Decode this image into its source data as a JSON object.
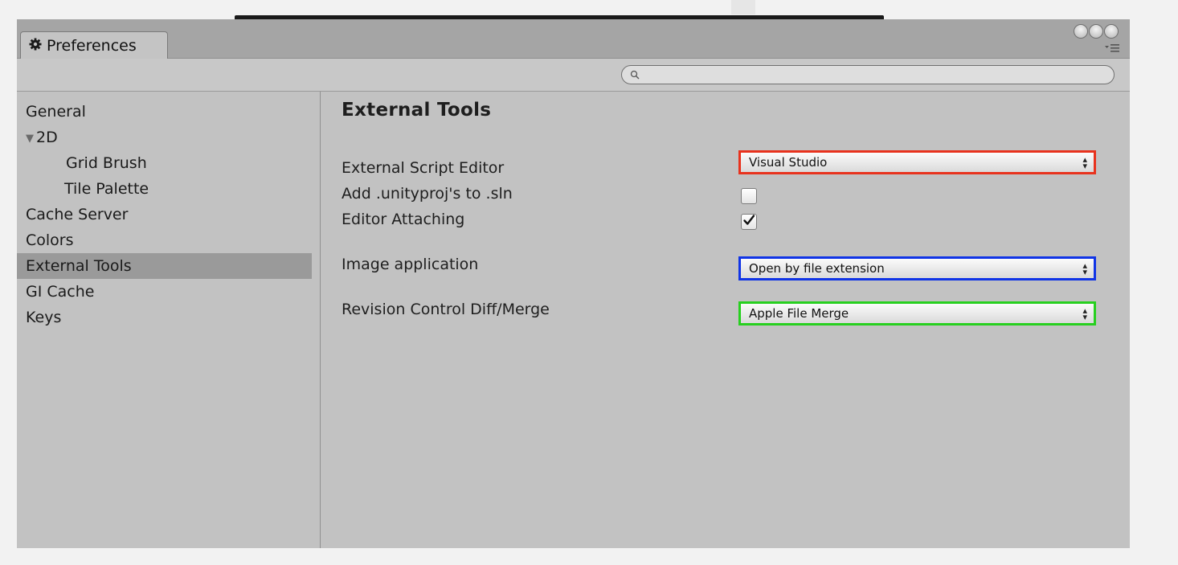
{
  "window": {
    "tab_title": "Preferences",
    "icons": {
      "tab": "gear-icon",
      "search": "search-icon",
      "menu": "menu-icon",
      "window_buttons": "circle-button-icon"
    }
  },
  "search": {
    "value": "",
    "placeholder": ""
  },
  "sidebar": {
    "items": [
      {
        "label": "General",
        "selected": false
      },
      {
        "label": "2D",
        "expanded": true
      },
      {
        "label": "Grid Brush"
      },
      {
        "label": "Tile Palette"
      },
      {
        "label": "Cache Server"
      },
      {
        "label": "Colors"
      },
      {
        "label": "External Tools",
        "selected": true
      },
      {
        "label": "GI Cache"
      },
      {
        "label": "Keys"
      }
    ]
  },
  "main": {
    "heading": "External Tools",
    "script_editor": {
      "label": "External Script Editor",
      "value": "Visual Studio",
      "highlight_color": "#e8321d"
    },
    "add_unityproj": {
      "label": "Add .unityproj's to .sln",
      "checked": false
    },
    "editor_attaching": {
      "label": "Editor Attaching",
      "checked": true
    },
    "image_application": {
      "label": "Image application",
      "value": "Open by file extension",
      "highlight_color": "#1034e6"
    },
    "revision_control": {
      "label": "Revision Control Diff/Merge",
      "value": "Apple File Merge",
      "highlight_color": "#27d01f"
    }
  }
}
